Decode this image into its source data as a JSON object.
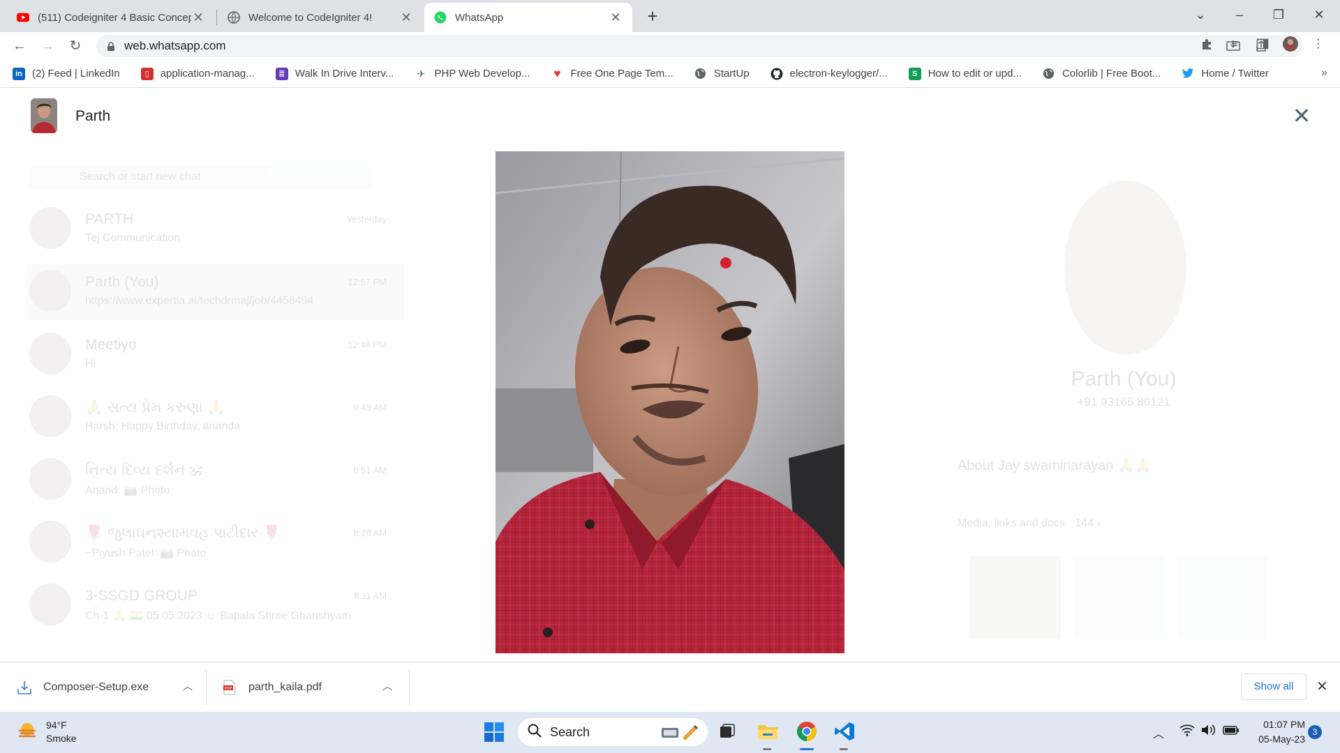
{
  "tabs": [
    {
      "title": "(511) Codeigniter 4 Basic Concep",
      "icon": "youtube-icon"
    },
    {
      "title": "Welcome to CodeIgniter 4!",
      "icon": "globe-icon"
    },
    {
      "title": "WhatsApp",
      "icon": "whatsapp-icon"
    }
  ],
  "address": {
    "url": "web.whatsapp.com"
  },
  "bookmarks": [
    {
      "label": "(2) Feed | LinkedIn",
      "icon": "linkedin-icon",
      "color": "#0a66c2"
    },
    {
      "label": "application-manag...",
      "icon": "app-manager-icon",
      "color": "#d32f2f"
    },
    {
      "label": "Walk In Drive Interv...",
      "icon": "forms-icon",
      "color": "#673ab7"
    },
    {
      "label": "PHP Web Develop...",
      "icon": "drone-icon",
      "color": "#607d8b"
    },
    {
      "label": "Free One Page Tem...",
      "icon": "heart-icon",
      "color": "#e53935"
    },
    {
      "label": "StartUp",
      "icon": "globe-icon",
      "color": "#5f6368"
    },
    {
      "label": "electron-keylogger/...",
      "icon": "github-icon",
      "color": "#24292e"
    },
    {
      "label": "How to edit or upd...",
      "icon": "sheets-icon",
      "color": "#0f9d58"
    },
    {
      "label": "Colorlib | Free Boot...",
      "icon": "globe-icon",
      "color": "#5f6368"
    },
    {
      "label": "Home / Twitter",
      "icon": "twitter-icon",
      "color": "#1d9bf0"
    }
  ],
  "viewer": {
    "contact_name": "Parth"
  },
  "background": {
    "search_placeholder": "Search or start new chat",
    "chats": [
      {
        "name": "PARTH",
        "time": "Yesterday",
        "preview": "Tej Communication"
      },
      {
        "name": "Parth (You)",
        "time": "12:57 PM",
        "preview": "https://www.expertia.ai/techdrmaj/job/4458494"
      },
      {
        "name": "Meetiyo",
        "time": "12:48 PM",
        "preview": "Hi"
      },
      {
        "name": "🙏 સત્ય પ્રેમ કરુણા 🙏",
        "time": "9:43 AM",
        "preview": "Harsh: Happy Birthday, ananda"
      },
      {
        "name": "નિત્ય દિવ્ય દર્શન 🕉",
        "time": "8:51 AM",
        "preview": "Anand: 📷 Photo"
      },
      {
        "name": "🌹 જુલાઘનશ્યામવહ પાટીદાર 🌹",
        "time": "8:28 AM",
        "preview": "~Piyush Patel: 📷 Photo"
      },
      {
        "name": "3-SSGD GROUP",
        "time": "8:11 AM",
        "preview": "Ch-1 🙏 🇮🇳 05.05.2023 ☺ Bapala Shree Ghanshyam"
      }
    ],
    "profile": {
      "name": "Parth (You)",
      "phone": "+91 93165 80121",
      "about": "About Jay swaminarayan 🙏🙏",
      "media_label": "Media, links and docs",
      "media_count": "144"
    }
  },
  "downloads": [
    {
      "filename": "Composer-Setup.exe",
      "icon": "download-file-icon"
    },
    {
      "filename": "parth_kaila.pdf",
      "icon": "pdf-icon"
    }
  ],
  "downloads_bar": {
    "show_all": "Show all"
  },
  "taskbar": {
    "weather_temp": "94°F",
    "weather_desc": "Smoke",
    "search_label": "Search",
    "time": "01:07 PM",
    "date": "05-May-23",
    "notification_count": "3"
  }
}
